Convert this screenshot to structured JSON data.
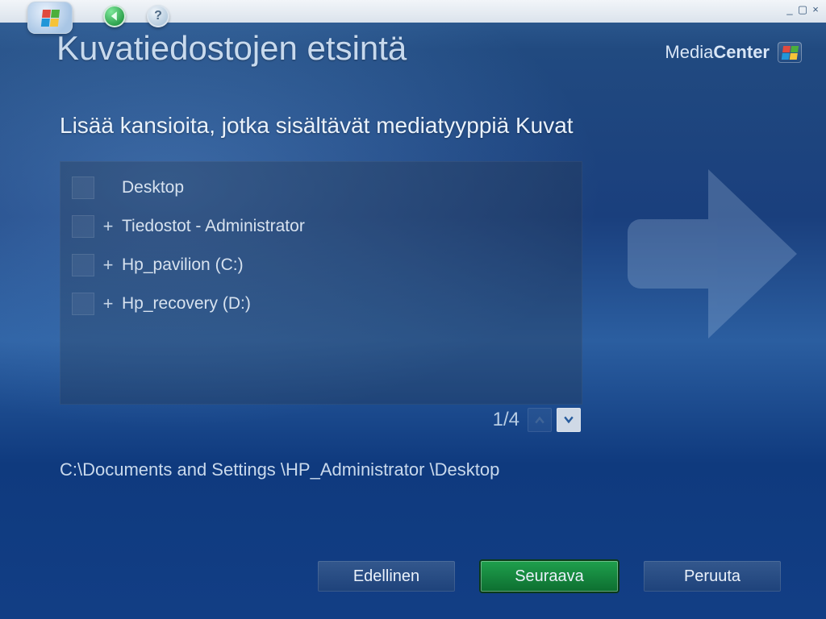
{
  "window": {
    "minimize": "_",
    "maximize": "▢",
    "close": "×"
  },
  "nav": {
    "back": "◄",
    "help": "?"
  },
  "page_title": "Kuvatiedostojen etsintä",
  "brand": {
    "light": "Media",
    "bold": "Center"
  },
  "section_heading": "Lisää kansioita, jotka sisältävät mediatyyppiä Kuvat",
  "folders": [
    {
      "expandable": false,
      "label": "Desktop"
    },
    {
      "expandable": true,
      "label": "Tiedostot - Administrator"
    },
    {
      "expandable": true,
      "label": "Hp_pavilion (C:)"
    },
    {
      "expandable": true,
      "label": "Hp_recovery (D:)"
    }
  ],
  "pager": {
    "count": "1/4"
  },
  "current_path": "C:\\Documents and Settings \\HP_Administrator \\Desktop",
  "buttons": {
    "previous": "Edellinen",
    "next": "Seuraava",
    "cancel": "Peruuta"
  }
}
